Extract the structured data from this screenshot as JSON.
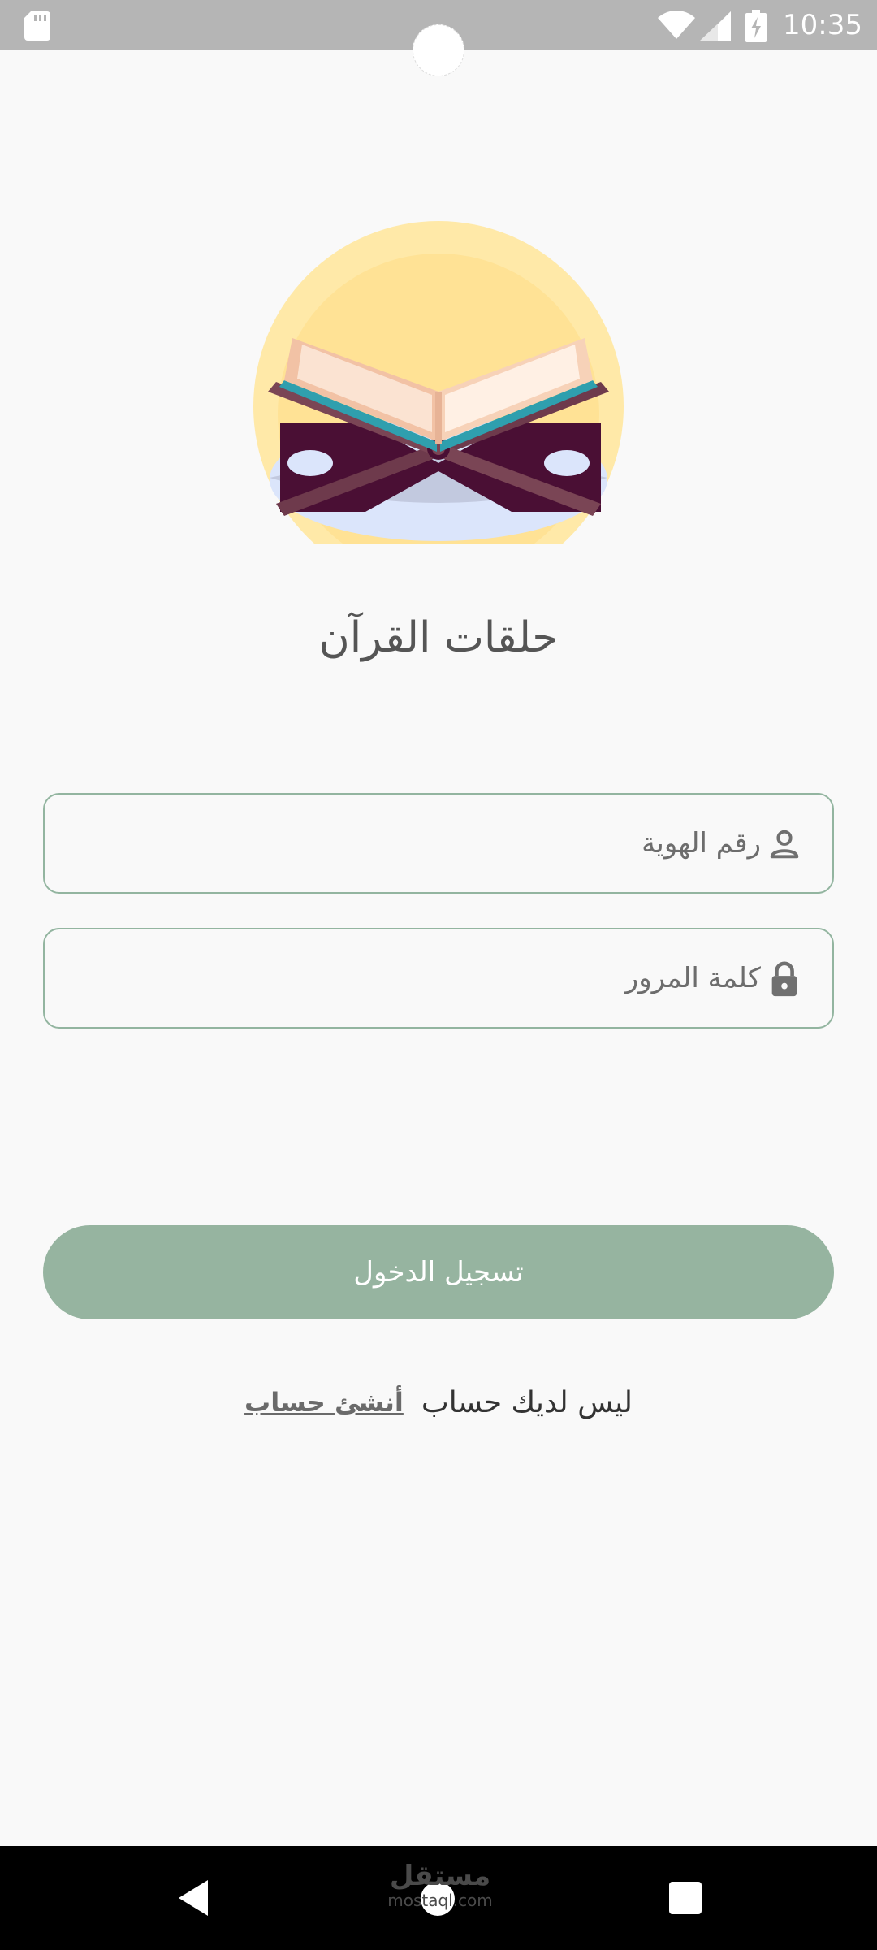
{
  "status_bar": {
    "time": "10:35",
    "icons": [
      "sd-card-icon",
      "wifi-icon",
      "signal-icon",
      "battery-charging-icon"
    ]
  },
  "app": {
    "title": "حلقات القرآن",
    "illustration": "quran-on-stand-illustration"
  },
  "form": {
    "id_field": {
      "placeholder": "رقم الهوية",
      "value": "",
      "icon": "person-icon"
    },
    "password_field": {
      "placeholder": "كلمة المرور",
      "value": "",
      "icon": "lock-icon"
    },
    "login_button": "تسجيل الدخول"
  },
  "register": {
    "prompt": "ليس لديك حساب",
    "link": "أنشئ حساب"
  },
  "watermark": {
    "main": "مستقل",
    "sub": "mostaql.com"
  },
  "nav_bar": {
    "icons": [
      "back-icon",
      "home-icon",
      "recent-apps-icon"
    ]
  },
  "colors": {
    "accent": "#96b4a0",
    "field_border": "#93b5a0",
    "background": "#f9f9f9",
    "status_bar": "#b5b5b5"
  }
}
